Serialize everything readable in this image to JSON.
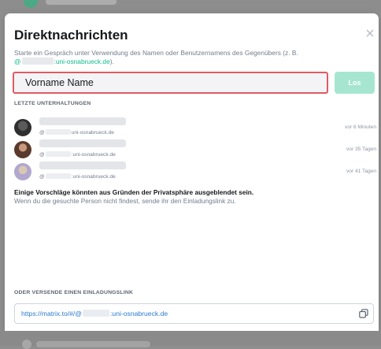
{
  "dialog": {
    "title": "Direktnachrichten",
    "close_glyph": "×",
    "subtitle_prefix": "Starte ein Gespräch unter Verwendung des Namen oder Benutzernamens des Gegenübers (z. B.",
    "subtitle_at": "@",
    "subtitle_domain": ":uni-osnabrueck.de",
    "subtitle_suffix": ")."
  },
  "search": {
    "placeholder": "Vorname Name",
    "value": ""
  },
  "go_button": {
    "label": "Los"
  },
  "recent": {
    "heading": "LETZTE UNTERHALTUNGEN",
    "items": [
      {
        "at": "@",
        "domain": "uni-osnabrueck.de",
        "time": "vor 6 Minuten",
        "avatar_color": "#2f2f2f"
      },
      {
        "at": "@",
        "domain": ":uni-osnabrueck.de",
        "time": "vor 35 Tagen",
        "avatar_color": "#5a3a2c"
      },
      {
        "at": "@",
        "domain": ":uni-osnabrueck.de",
        "time": "vor 41 Tagen",
        "avatar_color": "#b1a7cf"
      }
    ]
  },
  "hint": {
    "bold": "Einige Vorschläge könnten aus Gründen der Privatsphäre ausgeblendet sein.",
    "regular": "Wenn du die gesuchte Person nicht findest, sende ihr den Einladungslink zu."
  },
  "invite": {
    "heading": "ODER VERSENDE EINEN EINLADUNGSLINK",
    "link_prefix": "https://matrix.to/#/@",
    "link_suffix": ":uni-osnabrueck.de",
    "copy_icon": "copy-icon"
  },
  "colors": {
    "accent": "#0dbd8b",
    "button_disabled": "#a6e6d1",
    "input_border": "#e05a64",
    "link": "#2a7bd0"
  }
}
